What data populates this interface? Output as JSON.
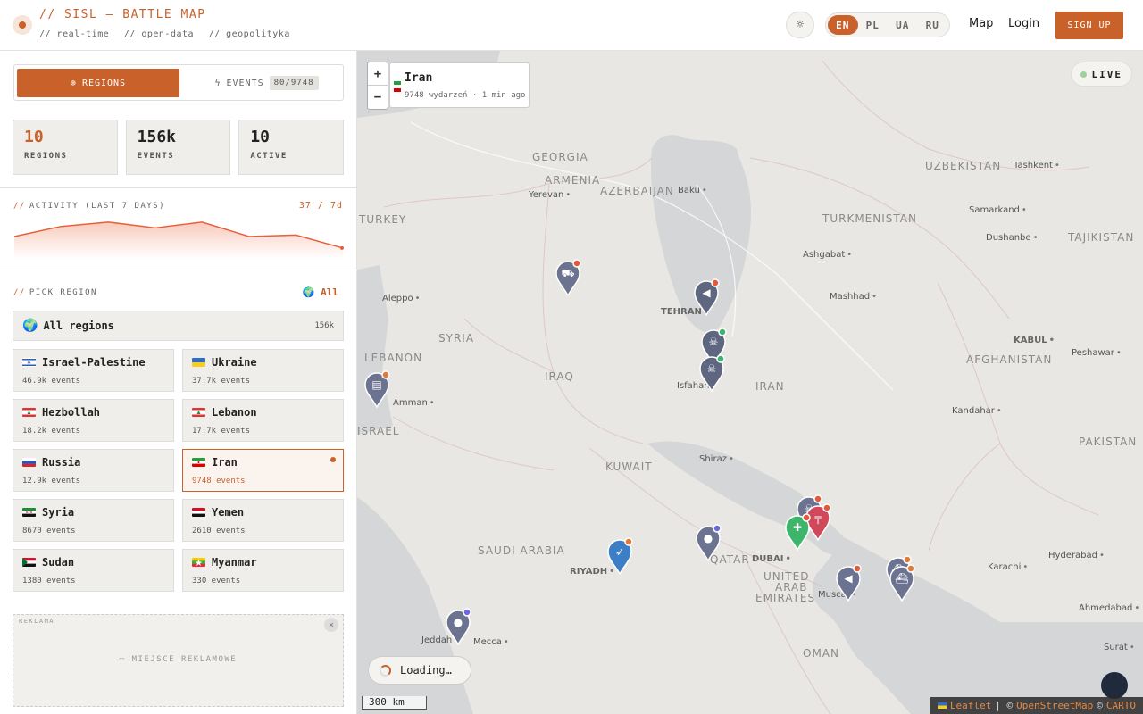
{
  "header": {
    "title": "// SISL – BATTLE MAP",
    "tags": [
      "// real-time",
      "// open-data",
      "// geopolityka"
    ],
    "languages": [
      {
        "code": "EN",
        "active": true
      },
      {
        "code": "PL",
        "active": false
      },
      {
        "code": "UA",
        "active": false
      },
      {
        "code": "RU",
        "active": false
      }
    ],
    "nav_map": "Map",
    "nav_login": "Login",
    "signup": "SIGN UP",
    "theme_icon": "sun-icon",
    "accent_color": "#c9612a"
  },
  "sidebar": {
    "tabs": {
      "regions_label": "REGIONS",
      "events_label": "EVENTS",
      "events_badge": "80/9748"
    },
    "stats": [
      {
        "value": "10",
        "label": "REGIONS"
      },
      {
        "value": "156k",
        "label": "EVENTS"
      },
      {
        "value": "10",
        "label": "ACTIVE"
      }
    ],
    "activity": {
      "label": "ACTIVITY (LAST 7 DAYS)",
      "count": "37 / 7d",
      "values": [
        13,
        20,
        23,
        19,
        23,
        13,
        14,
        5
      ]
    },
    "pick": {
      "label": "PICK REGION",
      "all_link": "All",
      "all_icon": "globe-icon"
    },
    "all_regions": {
      "name": "All regions",
      "count": "156k"
    },
    "regions": [
      {
        "name": "Israel-Palestine",
        "count": "46.9k events",
        "flag": "israel"
      },
      {
        "name": "Ukraine",
        "count": "37.7k events",
        "flag": "ukraine"
      },
      {
        "name": "Hezbollah",
        "count": "18.2k events",
        "flag": "lebanon"
      },
      {
        "name": "Lebanon",
        "count": "17.7k events",
        "flag": "lebanon"
      },
      {
        "name": "Russia",
        "count": "12.9k events",
        "flag": "russia"
      },
      {
        "name": "Iran",
        "count": "9748 events",
        "flag": "iran",
        "selected": true
      },
      {
        "name": "Syria",
        "count": "8670 events",
        "flag": "syria"
      },
      {
        "name": "Yemen",
        "count": "2610 events",
        "flag": "yemen"
      },
      {
        "name": "Sudan",
        "count": "1380 events",
        "flag": "sudan"
      },
      {
        "name": "Myanmar",
        "count": "330 events",
        "flag": "myanmar"
      }
    ],
    "ad": {
      "label": "REKLAMA",
      "text": "MIEJSCE REKLAMOWE",
      "close": "×"
    }
  },
  "map": {
    "zoom_in": "+",
    "zoom_out": "−",
    "info": {
      "title": "Iran",
      "subtitle": "9748 wydarzeń · 1 min ago"
    },
    "live": "LIVE",
    "loading": "Loading…",
    "scale": "300 km",
    "attribution": {
      "leaflet": "Leaflet",
      "sep1": "| ©",
      "osm": "OpenStreetMap",
      "sep2": "©",
      "carto": "CARTO"
    },
    "countries": [
      "GEORGIA",
      "ARMENIA",
      "AZERBAIJAN",
      "TURKEY",
      "TURKMENISTAN",
      "UZBEKISTAN",
      "TAJIKISTAN",
      "SYRIA",
      "LEBANON",
      "IRAQ",
      "IRAN",
      "AFGHANISTAN",
      "PAKISTAN",
      "KUWAIT",
      "SAUDI ARABIA",
      "QATAR",
      "UNITED",
      "ARAB",
      "EMIRATES",
      "OMAN",
      "ISRAEL"
    ],
    "cities": [
      "Yerevan",
      "Baku",
      "Tashkent",
      "Samarkand",
      "Dushanbe",
      "Ashgabat",
      "Mashhad",
      "Aleppo",
      "TEHRAN",
      "KABUL",
      "Peshawar",
      "Isfahan",
      "Kandahar",
      "Amman",
      "Shiraz",
      "Hyderabad",
      "Karachi",
      "DUBAI",
      "Muscat",
      "RIYADH",
      "Ahmedabad",
      "Jeddah",
      "Mecca",
      "Surat"
    ],
    "markers": [
      {
        "type": "helicopter",
        "icon": "helicopter-icon",
        "color": "#6b7390",
        "dot": "#e25a3b"
      },
      {
        "type": "protest",
        "icon": "megaphone-icon",
        "color": "#5f6680",
        "dot": "#e25a3b"
      },
      {
        "type": "death",
        "icon": "skull-icon",
        "color": "#5f6680",
        "dot": "#3cb371"
      },
      {
        "type": "death",
        "icon": "skull-icon",
        "color": "#5f6680",
        "dot": "#3cb371"
      },
      {
        "type": "news",
        "icon": "newspaper-icon",
        "color": "#6b7390",
        "dot": "#e07a3b"
      },
      {
        "type": "strike",
        "icon": "rocket-icon",
        "color": "#3d7fc7",
        "dot": "#e07a3b"
      },
      {
        "type": "statement",
        "icon": "microphone-icon",
        "color": "#6b7390",
        "dot": "#6a6adf"
      },
      {
        "type": "statement",
        "icon": "microphone-icon",
        "color": "#6b7390",
        "dot": "#6a6adf"
      },
      {
        "type": "death",
        "icon": "skull-icon",
        "color": "#6b7390",
        "dot": "#e25a3b"
      },
      {
        "type": "armed",
        "icon": "gun-icon",
        "color": "#d1485b",
        "dot": "#e25a3b"
      },
      {
        "type": "aid",
        "icon": "ambulance-icon",
        "color": "#3db56a",
        "dot": "#e25a3b"
      },
      {
        "type": "protest",
        "icon": "megaphone-icon",
        "color": "#6b7390",
        "dot": "#e25a3b"
      },
      {
        "type": "naval",
        "icon": "ship-icon",
        "color": "#6b7390",
        "dot": "#e07a3b"
      },
      {
        "type": "naval",
        "icon": "ship-icon",
        "color": "#6b7390",
        "dot": "#e07a3b"
      }
    ]
  }
}
